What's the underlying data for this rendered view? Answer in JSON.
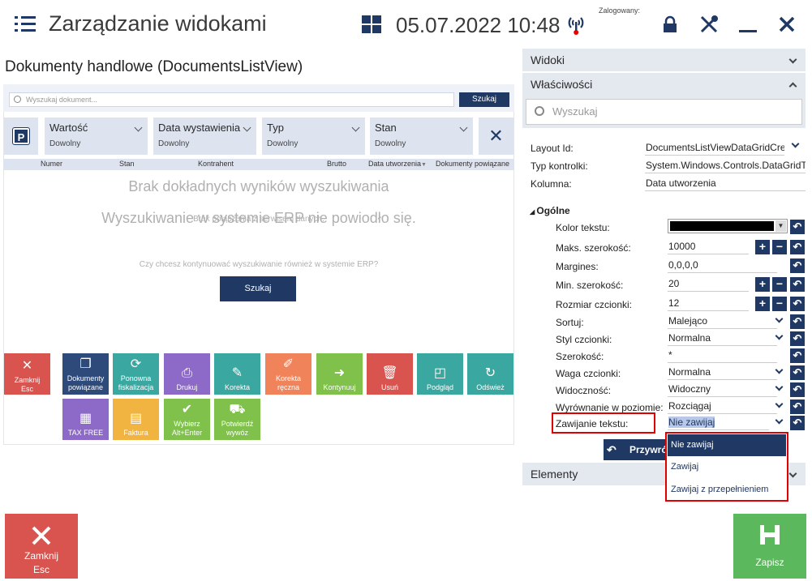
{
  "header": {
    "title": "Zarządzanie widokami",
    "datetime": "05.07.2022 10:48",
    "logged_label": "Zalogowany:"
  },
  "view": {
    "title": "Dokumenty handlowe (DocumentsListView)",
    "search_placeholder": "Wyszukaj dokument...",
    "search_button": "Szukaj",
    "filters": [
      {
        "label": "Wartość",
        "value": "Dowolny"
      },
      {
        "label": "Data wystawienia",
        "value": "Dowolny"
      },
      {
        "label": "Typ",
        "value": "Dowolny"
      },
      {
        "label": "Stan",
        "value": "Dowolny"
      }
    ],
    "columns": [
      "Numer",
      "Stan",
      "Kontrahent",
      "Brutto",
      "Data utworzenia",
      "Dokumenty powiązane"
    ],
    "sort_indicator": "▼",
    "messages": {
      "no_results": "Brak dokładnych wyników wyszukiwania",
      "erp_failed": "Wyszukiwanie w systemie ERP nie powiodło się.",
      "no_connection": "Brak połączenia z serwisem danych.",
      "continue_question": "Czy chcesz kontynuować wyszukiwanie również w systemie ERP?"
    },
    "retry_button": "Szukaj",
    "tiles": [
      {
        "label": "Zamknij\nEsc",
        "icon": "close-icon",
        "color": "#d9534f"
      },
      {
        "label": "Dokumenty powiązane",
        "icon": "documents-icon",
        "color": "#2d4a7a"
      },
      {
        "label": "Ponowna fiskalizacja",
        "icon": "refresh-doc-icon",
        "color": "#3aa8a0"
      },
      {
        "label": "Drukuj",
        "icon": "print-icon",
        "color": "#8e6ac8"
      },
      {
        "label": "Korekta",
        "icon": "correction-icon",
        "color": "#3aa8a0"
      },
      {
        "label": "Korekta ręczna",
        "icon": "manual-correction-icon",
        "color": "#f0835a"
      },
      {
        "label": "Kontynuuj",
        "icon": "continue-icon",
        "color": "#7fc14a"
      },
      {
        "label": "Usuń",
        "icon": "trash-icon",
        "color": "#d9534f"
      },
      {
        "label": "Podgląd",
        "icon": "preview-icon",
        "color": "#3aa8a0"
      },
      {
        "label": "Odśwież",
        "icon": "refresh-icon",
        "color": "#3aa8a0"
      },
      {
        "label": "TAX FREE",
        "icon": "taxfree-icon",
        "color": "#8e6ac8"
      },
      {
        "label": "Faktura",
        "icon": "invoice-icon",
        "color": "#f2b441"
      },
      {
        "label": "Wybierz\nAlt+Enter",
        "icon": "check-icon",
        "color": "#7fc14a"
      },
      {
        "label": "Potwierdź wywóz",
        "icon": "truck-icon",
        "color": "#7fc14a"
      }
    ]
  },
  "panel": {
    "views_label": "Widoki",
    "properties_label": "Właściwości",
    "search_placeholder": "Wyszukaj",
    "layout_id_label": "Layout Id:",
    "layout_id_value": "DocumentsListViewDataGridCreatedDate",
    "control_type_label": "Typ kontrolki:",
    "control_type_value": "System.Windows.Controls.DataGridTextColumn",
    "column_label": "Kolumna:",
    "column_value": "Data utworzenia",
    "section_general": "Ogólne",
    "props": [
      {
        "label": "Kolor tekstu:",
        "value": ""
      },
      {
        "label": "Maks. szerokość:",
        "value": "10000"
      },
      {
        "label": "Margines:",
        "value": "0,0,0,0"
      },
      {
        "label": "Min. szerokość:",
        "value": "20"
      },
      {
        "label": "Rozmiar czcionki:",
        "value": "12"
      },
      {
        "label": "Sortuj:",
        "value": "Malejąco"
      },
      {
        "label": "Styl czcionki:",
        "value": "Normalna"
      },
      {
        "label": "Szerokość:",
        "value": "*"
      },
      {
        "label": "Waga czcionki:",
        "value": "Normalna"
      },
      {
        "label": "Widoczność:",
        "value": "Widoczny"
      },
      {
        "label": "Wyrównanie w poziomie:",
        "value": "Rozciągaj"
      },
      {
        "label": "Zawijanie tekstu:",
        "value": "Nie zawijaj"
      }
    ],
    "wrap_options": [
      "Nie zawijaj",
      "Zawijaj",
      "Zawijaj z przepełnieniem"
    ],
    "restore_button": "Przywróć",
    "elements_label": "Elementy"
  },
  "footer": {
    "close_label": "Zamknij",
    "close_key": "Esc",
    "save_label": "Zapisz"
  },
  "colors": {
    "primary": "#1f3864",
    "danger": "#d9534f",
    "success": "#5cb85c",
    "highlight": "#e00000"
  }
}
